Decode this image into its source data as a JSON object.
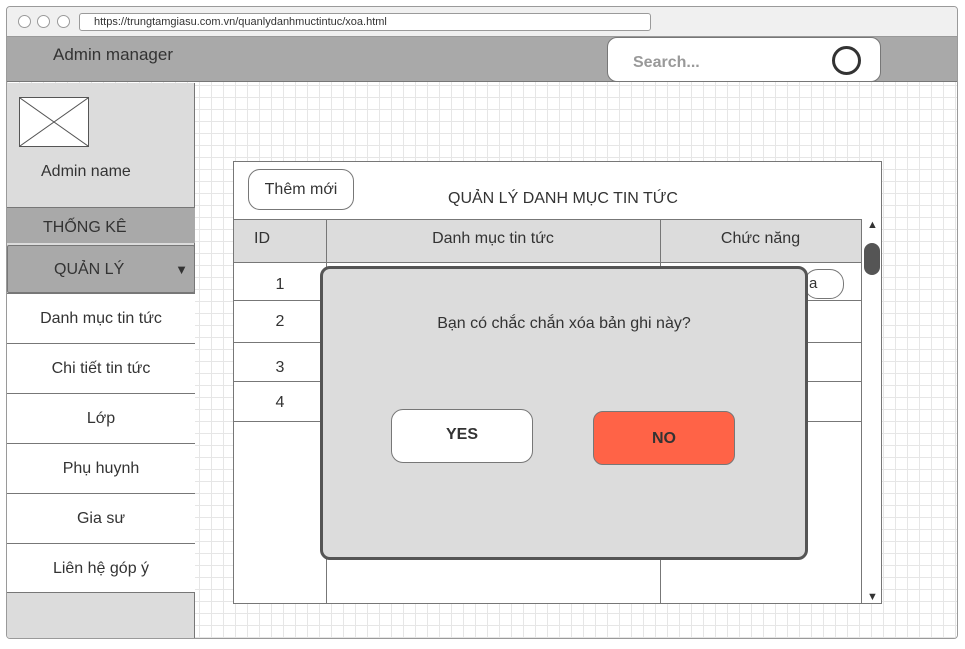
{
  "browser": {
    "url": "https://trungtamgiasu.com.vn/quanlydanhmuctintuc/xoa.html"
  },
  "header": {
    "title": "Admin manager",
    "search_placeholder": "Search..."
  },
  "sidebar": {
    "admin_name": "Admin name",
    "stats_label": "THỐNG KÊ",
    "manage_label": "QUẢN LÝ",
    "items": [
      {
        "label": "Danh mục tin tức"
      },
      {
        "label": "Chi tiết tin tức"
      },
      {
        "label": "Lớp"
      },
      {
        "label": "Phụ huynh"
      },
      {
        "label": "Gia sư"
      },
      {
        "label": "Liên hệ góp ý"
      }
    ]
  },
  "main": {
    "add_button": "Thêm mới",
    "title": "QUẢN LÝ DANH MỤC TIN TỨC",
    "columns": [
      "ID",
      "Danh mục tin tức",
      "Chức năng"
    ],
    "rows": [
      {
        "id": "1",
        "action_fragment": "a"
      },
      {
        "id": "2"
      },
      {
        "id": "3"
      },
      {
        "id": "4"
      }
    ]
  },
  "dialog": {
    "message": "Bạn có chắc chắn xóa bản ghi này?",
    "yes_label": "YES",
    "no_label": "NO",
    "no_color": "#ff6347"
  },
  "colors": {
    "header_bg": "#a9a9a9",
    "sidebar_bg": "#dcdcdc",
    "dialog_bg": "#dcdcdc",
    "no_button": "#ff6347"
  },
  "icons": {
    "search": "search-icon",
    "avatar": "image-placeholder-icon",
    "dropdown": "caret-down-icon",
    "scroll_up": "scroll-up-arrow-icon",
    "scroll_down": "scroll-down-arrow-icon"
  }
}
